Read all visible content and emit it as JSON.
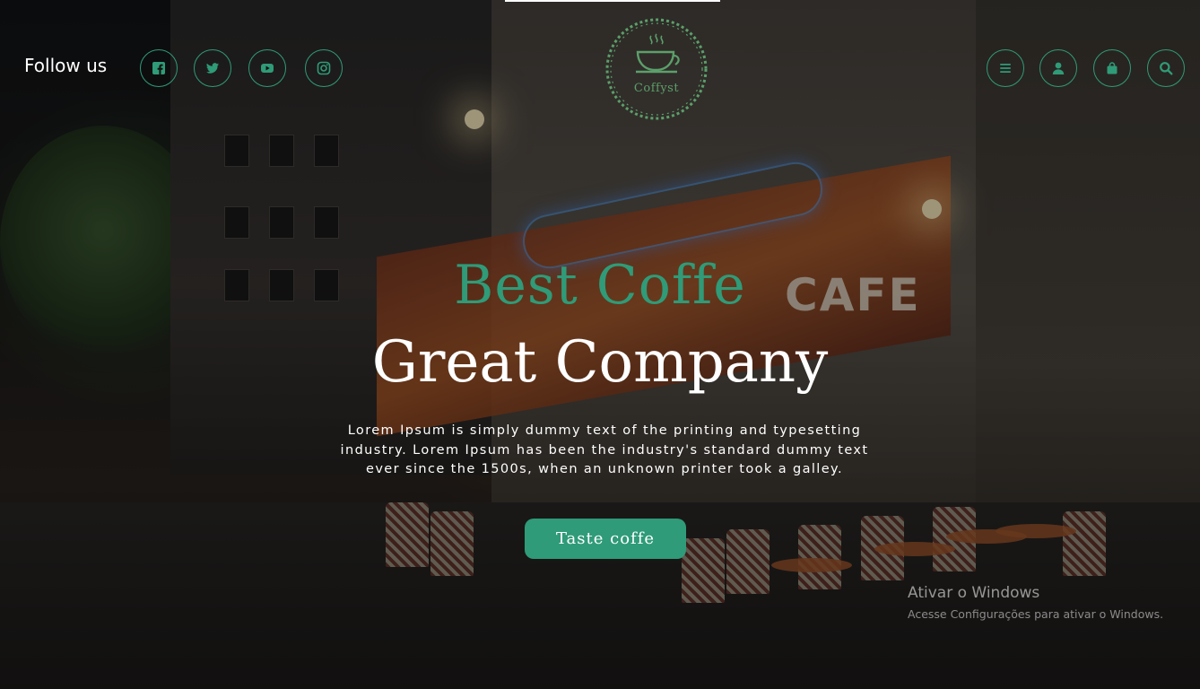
{
  "header": {
    "follow_label": "Follow us",
    "social": [
      {
        "icon": "facebook-icon"
      },
      {
        "icon": "twitter-icon"
      },
      {
        "icon": "youtube-icon"
      },
      {
        "icon": "instagram-icon"
      }
    ],
    "actions": [
      {
        "icon": "menu-icon"
      },
      {
        "icon": "user-icon"
      },
      {
        "icon": "shopping-bag-icon"
      },
      {
        "icon": "search-icon"
      }
    ],
    "logo_text": "Coffyst"
  },
  "hero": {
    "title_line1": "Best Coffe",
    "title_line2": "Great Company",
    "description": "Lorem Ipsum is simply dummy text of the printing and typesetting industry. Lorem Ipsum has been the industry's standard dummy text ever since the 1500s, when an unknown printer took a galley.",
    "cta_label": "Taste coffe"
  },
  "background": {
    "cafe_sign": "CAFE"
  },
  "watermark": {
    "title": "Ativar o Windows",
    "subtitle": "Acesse Configurações para ativar o Windows."
  },
  "colors": {
    "accent": "#2f9b78",
    "logo": "#5c9f6a",
    "text": "#ffffff"
  }
}
